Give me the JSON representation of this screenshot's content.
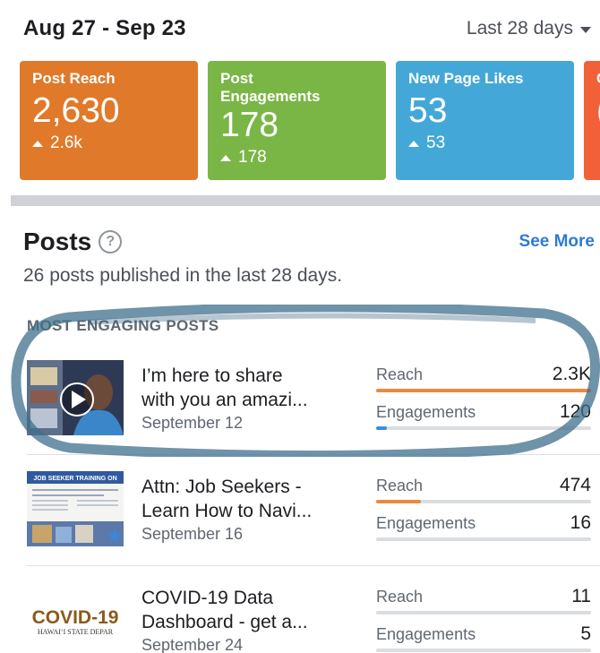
{
  "header": {
    "date_range": "Aug 27 - Sep 23",
    "range_select": "Last 28 days"
  },
  "cards": [
    {
      "title_line1": "Post Reach",
      "title_line2": "",
      "value": "2,630",
      "delta": "2.6k",
      "color": "#e07a2a"
    },
    {
      "title_line1": "Post",
      "title_line2": "Engagements",
      "value": "178",
      "delta": "178",
      "color": "#7ab646"
    },
    {
      "title_line1": "New Page Likes",
      "title_line2": "",
      "value": "53",
      "delta": "53",
      "color": "#43a8d8"
    },
    {
      "title_line1": "C",
      "title_line2": "",
      "value": "(",
      "delta": "",
      "color": "#f2603a"
    }
  ],
  "posts": {
    "title": "Posts",
    "see_more": "See More",
    "subtitle": "26 posts published in the last 28 days.",
    "section_label": "MOST ENGAGING POSTS",
    "items": [
      {
        "title_line1": "I’m here to share",
        "title_line2": "with you an amazi...",
        "date": "September 12",
        "reach_label": "Reach",
        "reach_value": "2.3K",
        "reach_fraction": 1.0,
        "engagements_label": "Engagements",
        "engagements_value": "120",
        "engagements_fraction": 0.05
      },
      {
        "title_line1": "Attn: Job Seekers -",
        "title_line2": "Learn How to Navi...",
        "date": "September 16",
        "reach_label": "Reach",
        "reach_value": "474",
        "reach_fraction": 0.21,
        "engagements_label": "Engagements",
        "engagements_value": "16",
        "engagements_fraction": 0.0,
        "thumb_caption": "JOB SEEKER TRAINING ON"
      },
      {
        "title_line1": "COVID-19 Data",
        "title_line2": "Dashboard - get a...",
        "date": "September 24",
        "reach_label": "Reach",
        "reach_value": "11",
        "reach_fraction": 0.0,
        "engagements_label": "Engagements",
        "engagements_value": "5",
        "engagements_fraction": 0.0,
        "thumb_logo": "COVID-19",
        "thumb_logo_sub": "HAWAI‘I STATE DEPAR"
      }
    ]
  }
}
